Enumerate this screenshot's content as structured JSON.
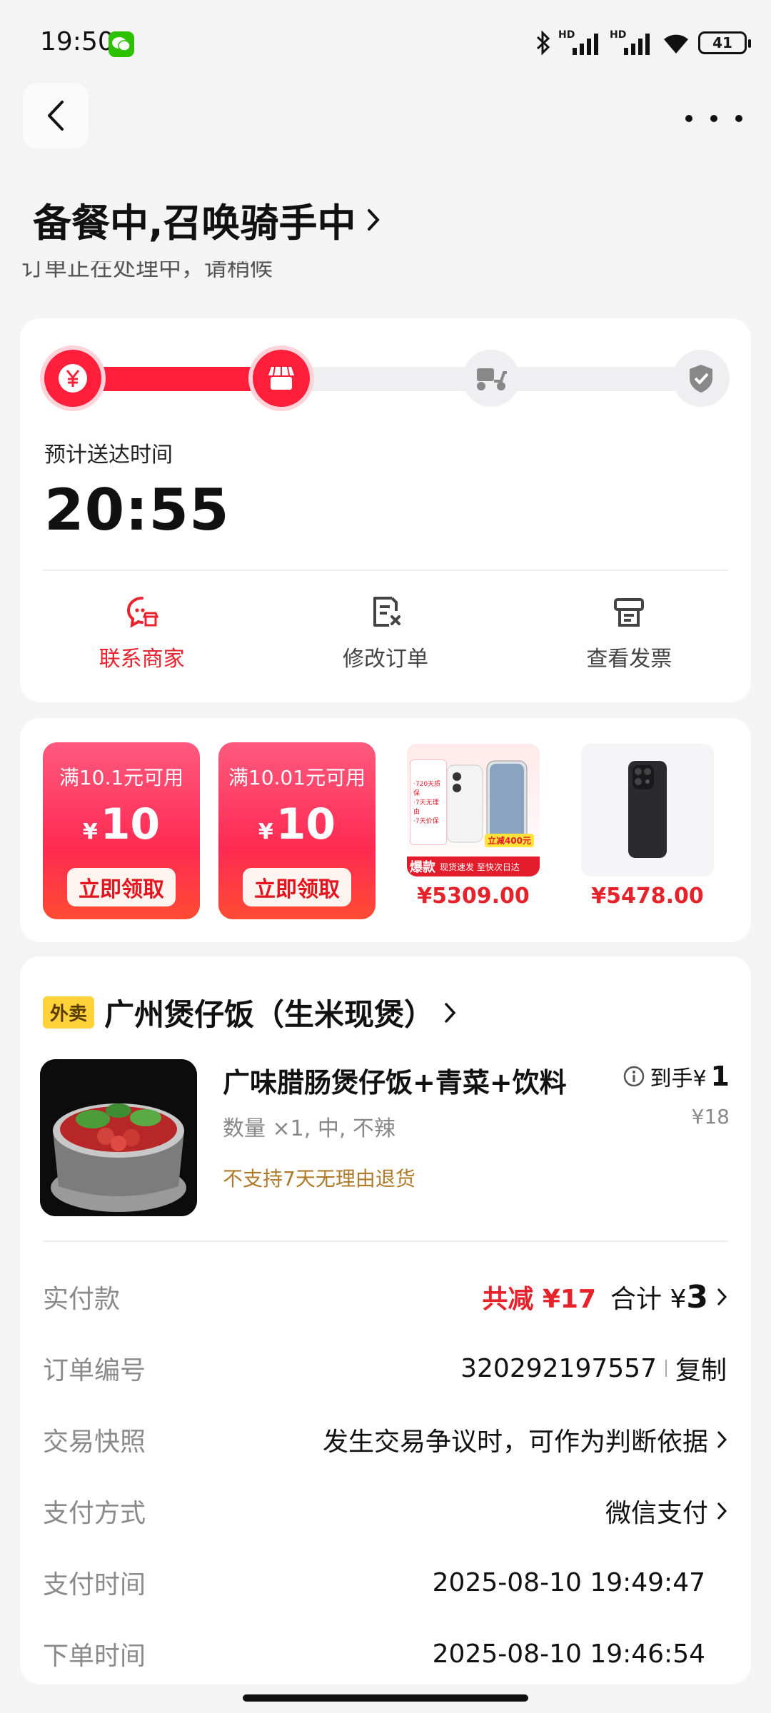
{
  "status": {
    "time": "19:50",
    "battery": "41",
    "signal1_label": "HD",
    "signal2_label": "HD"
  },
  "header": {
    "title": "备餐中,召唤骑手中",
    "notice": "订单正在处理中，请稍候"
  },
  "progress": {
    "fraction": 0.32,
    "eta_label": "预计送达时间",
    "eta_time": "20:55"
  },
  "actions": [
    {
      "label": "联系商家",
      "icon": "chat-store-icon"
    },
    {
      "label": "修改订单",
      "icon": "edit-order-icon"
    },
    {
      "label": "查看发票",
      "icon": "invoice-icon"
    }
  ],
  "promo": {
    "coupons": [
      {
        "condition": "满10.1元可用",
        "currency": "¥",
        "amount": "10",
        "button": "立即领取"
      },
      {
        "condition": "满10.01元可用",
        "currency": "¥",
        "amount": "10",
        "button": "立即领取"
      }
    ],
    "products": [
      {
        "price": "¥5309.00",
        "badge": "爆款",
        "note": "现货速发 至快次日达",
        "perks": "·720天质保\n·7天无理由\n·7天价保",
        "discount": "立减400元"
      },
      {
        "price": "¥5478.00"
      }
    ]
  },
  "order": {
    "tag": "外卖",
    "shop_name": "广州煲仔饭（生米现煲）",
    "item": {
      "title": "广味腊肠煲仔饭+青菜+饮料",
      "spec": "数量 ×1, 中, 不辣",
      "warning": "不支持7天无理由退货",
      "final_prefix": "到手¥",
      "final_value": "1",
      "original_price": "¥18"
    },
    "rows": {
      "paid_label": "实付款",
      "discount": "共减 ¥17",
      "total_prefix": "合计 ¥",
      "total_value": "3",
      "order_no_label": "订单编号",
      "order_no": "320292197557",
      "copy": "复制",
      "snapshot_label": "交易快照",
      "snapshot_value": "发生交易争议时，可作为判断依据",
      "pay_method_label": "支付方式",
      "pay_method_value": "微信支付",
      "pay_time_label": "支付时间",
      "pay_time_value": "2025-08-10 19:49:47",
      "order_time_label": "下单时间",
      "order_time_value": "2025-08-10 19:46:54"
    }
  }
}
